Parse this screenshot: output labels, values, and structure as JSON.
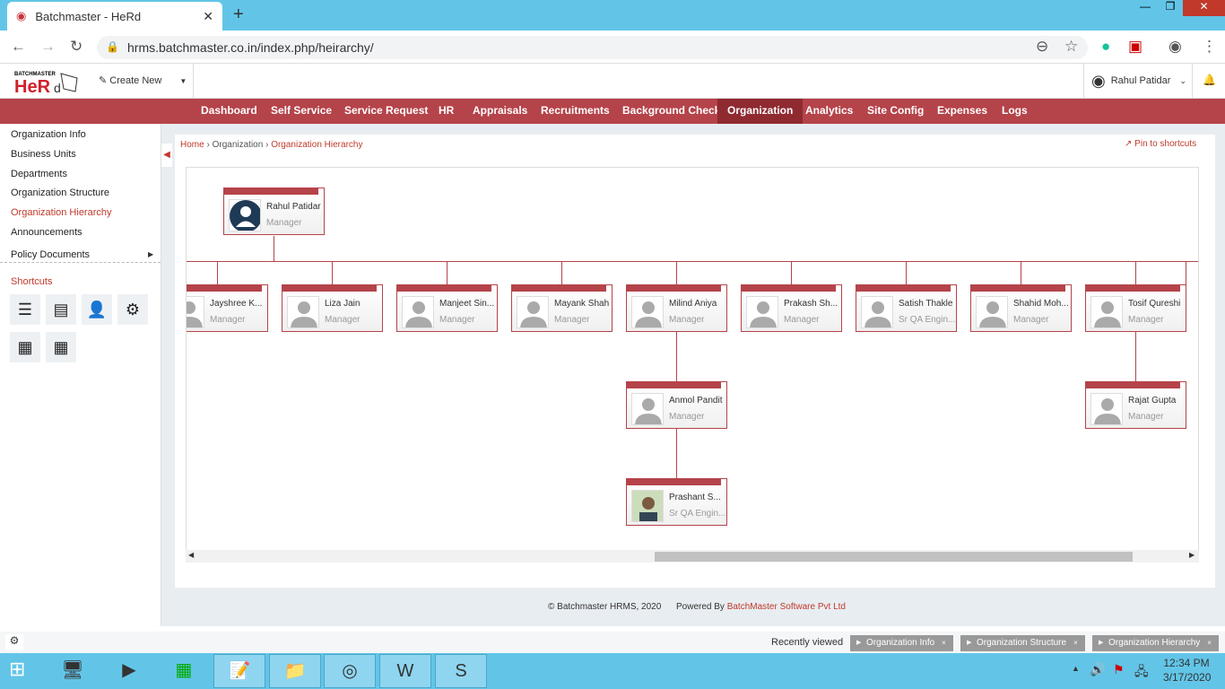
{
  "browser": {
    "tab_title": "Batchmaster - HeRd",
    "url": "hrms.batchmaster.co.in/index.php/heirarchy/"
  },
  "app": {
    "logo_text": "BATCHMASTER HeRd",
    "create_new": "Create New",
    "user_name": "Rahul Patidar"
  },
  "nav": [
    "Dashboard",
    "Self Service",
    "Service Request",
    "HR",
    "Appraisals",
    "Recruitments",
    "Background Check",
    "Organization",
    "Analytics",
    "Site Config",
    "Expenses",
    "Logs"
  ],
  "nav_active": "Organization",
  "sidebar": {
    "items": [
      "Organization Info",
      "Business Units",
      "Departments",
      "Organization Structure",
      "Organization Hierarchy",
      "Announcements",
      "Policy Documents"
    ],
    "active": "Organization Hierarchy",
    "shortcuts_title": "Shortcuts"
  },
  "breadcrumb": [
    "Home",
    "Organization",
    "Organization Hierarchy"
  ],
  "pin": "Pin to shortcuts",
  "hierarchy": {
    "root": {
      "name": "Rahul Patidar",
      "role": "Manager"
    },
    "children": [
      {
        "name": "Jayshree K...",
        "role": "Manager"
      },
      {
        "name": "Liza Jain",
        "role": "Manager"
      },
      {
        "name": "Manjeet Sin...",
        "role": "Manager"
      },
      {
        "name": "Mayank Shah",
        "role": "Manager"
      },
      {
        "name": "Milind Aniya",
        "role": "Manager"
      },
      {
        "name": "Prakash Sh...",
        "role": "Manager"
      },
      {
        "name": "Satish Thakle",
        "role": "Sr QA Engin..."
      },
      {
        "name": "Shahid Moh...",
        "role": "Manager"
      },
      {
        "name": "Tosif Qureshi",
        "role": "Manager"
      }
    ],
    "sub1": {
      "name": "Anmol Pandit",
      "role": "Manager"
    },
    "sub2": {
      "name": "Prashant S...",
      "role": "Sr QA Engin..."
    },
    "sub3": {
      "name": "Rajat Gupta",
      "role": "Manager"
    }
  },
  "footer": {
    "copyright": "© Batchmaster HRMS, 2020",
    "powered": "Powered By",
    "company": "BatchMaster Software Pvt Ltd"
  },
  "recent": {
    "label": "Recently viewed",
    "items": [
      "Organization Info",
      "Organization Structure",
      "Organization Hierarchy"
    ]
  },
  "clock": {
    "time": "12:34 PM",
    "date": "3/17/2020"
  },
  "colors": {
    "brand": "#b5434a",
    "taskbar": "#62c5e8"
  }
}
